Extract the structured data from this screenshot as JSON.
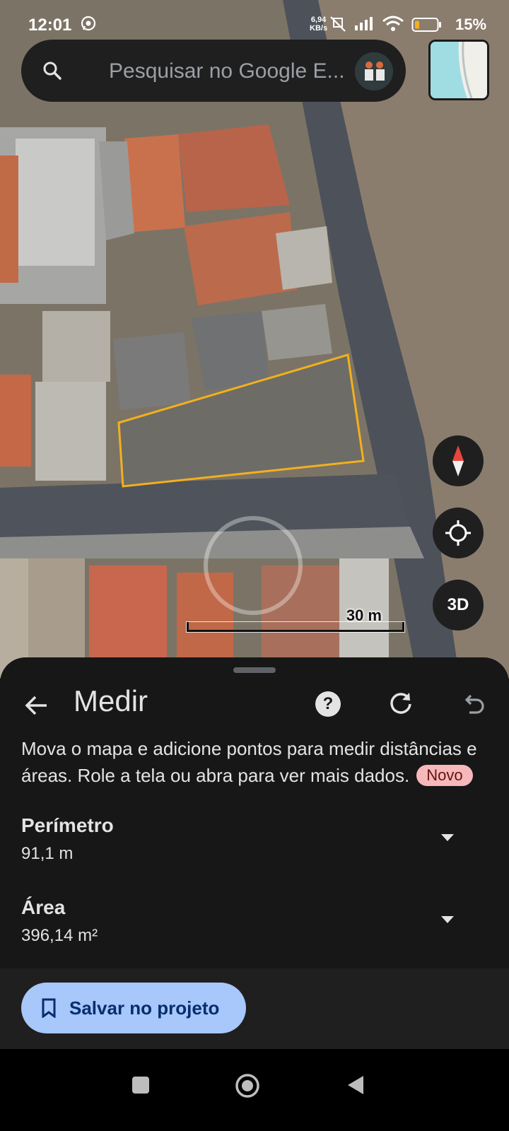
{
  "status_bar": {
    "time": "12:01",
    "speed_value": "6,94",
    "speed_unit": "KB/s",
    "battery_percent": "15%",
    "icons": [
      "whatsapp-icon",
      "mute-icon",
      "signal-icon",
      "wifi-icon",
      "battery-icon"
    ]
  },
  "search": {
    "placeholder": "Pesquisar no Google E..."
  },
  "map": {
    "scale_label": "30 m",
    "compass_icon": "compass-icon",
    "locate_icon": "my-location-icon",
    "view_3d_label": "3D",
    "polygon_color": "#f2b01e"
  },
  "sheet": {
    "title": "Medir",
    "help_label": "?",
    "description": "Mova o mapa e adicione pontos para medir distâncias e áreas. Role a tela ou abra para ver mais dados.",
    "badge": "Novo",
    "metrics": [
      {
        "label": "Perímetro",
        "value": "91,1 m"
      },
      {
        "label": "Área",
        "value": "396,14 m²"
      }
    ],
    "save_button": "Salvar no projeto"
  },
  "colors": {
    "sheet_bg": "#171717",
    "button_bg": "#a8c7fa",
    "badge_bg": "#f6b8ba"
  }
}
